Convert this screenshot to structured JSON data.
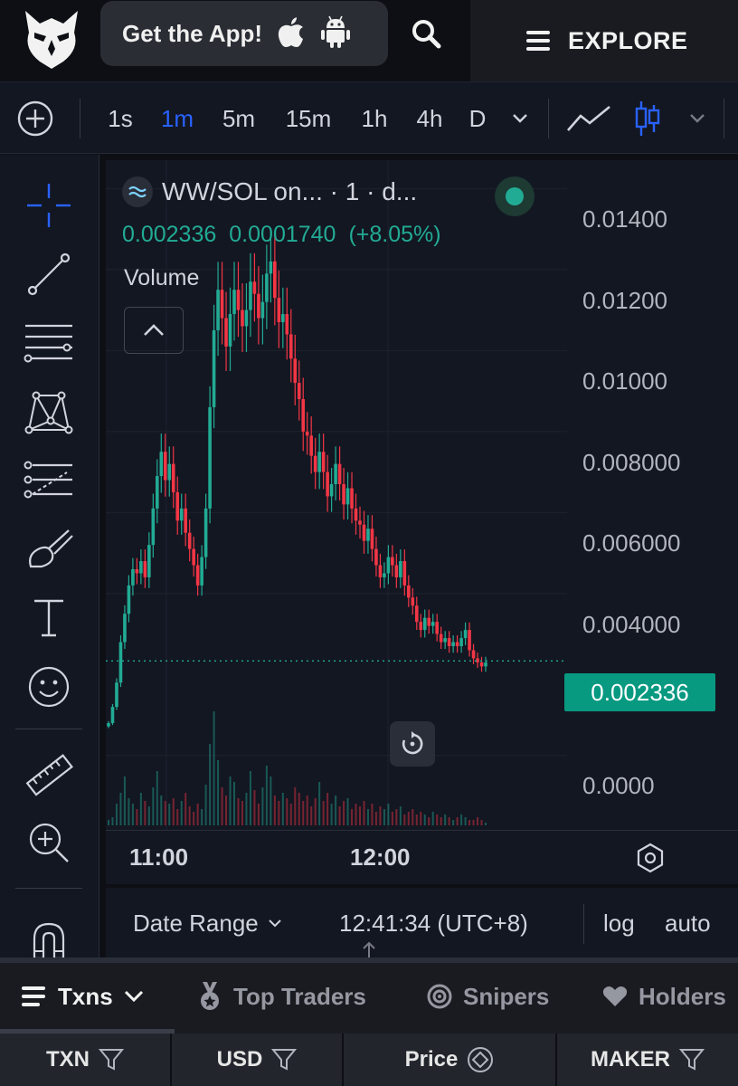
{
  "header": {
    "get_app_label": "Get the App!",
    "explore_label": "EXPLORE"
  },
  "toolbar": {
    "intervals": [
      "1s",
      "1m",
      "5m",
      "15m",
      "1h",
      "4h",
      "D"
    ],
    "active_interval": "1m"
  },
  "chart": {
    "legend_title": "WW/SOL on... · 1 · d...",
    "ohlc_last": "0.002336",
    "ohlc_change": "0.0001740",
    "ohlc_change_pct": "(+8.05%)",
    "volume_label": "Volume",
    "price_ticks": [
      "0.01400",
      "0.01200",
      "0.01000",
      "0.008000",
      "0.006000",
      "0.004000",
      "0.0000"
    ],
    "last_price_label": "0.002336",
    "time_ticks": [
      "11:00",
      "12:00"
    ],
    "colors": {
      "up": "#22ab94",
      "down": "#f23645",
      "accent": "#2962ff"
    }
  },
  "bottombar": {
    "date_range": "Date Range",
    "clock": "12:41:34 (UTC+8)",
    "log": "log",
    "auto": "auto"
  },
  "tabs": [
    {
      "label": "Txns"
    },
    {
      "label": "Top Traders"
    },
    {
      "label": "Snipers"
    },
    {
      "label": "Holders"
    }
  ],
  "table_header": [
    "TXN",
    "USD",
    "Price",
    "MAKER"
  ],
  "chart_data": {
    "type": "candlestick",
    "symbol": "WW/SOL",
    "interval": "1m",
    "x_ticks": [
      "11:00",
      "12:00"
    ],
    "y_ticks": [
      0.0,
      0.004,
      0.006,
      0.008,
      0.01,
      0.012,
      0.014
    ],
    "ylim": [
      0.0,
      0.0147
    ],
    "last_price": 0.002336,
    "grid": true,
    "close_path": [
      0.0008,
      0.0012,
      0.0018,
      0.0028,
      0.0035,
      0.0042,
      0.0046,
      0.0045,
      0.0048,
      0.0044,
      0.0052,
      0.0061,
      0.0069,
      0.0075,
      0.0068,
      0.0072,
      0.0065,
      0.0058,
      0.0061,
      0.0055,
      0.0051,
      0.0047,
      0.0042,
      0.0049,
      0.0061,
      0.0086,
      0.0105,
      0.0115,
      0.0108,
      0.0101,
      0.0109,
      0.0115,
      0.011,
      0.0106,
      0.011,
      0.0117,
      0.0114,
      0.0108,
      0.0112,
      0.0119,
      0.0122,
      0.0113,
      0.0107,
      0.0109,
      0.0104,
      0.0098,
      0.0092,
      0.0088,
      0.008,
      0.0079,
      0.0074,
      0.007,
      0.0075,
      0.007,
      0.0064,
      0.0067,
      0.0072,
      0.0067,
      0.0062,
      0.0066,
      0.0061,
      0.0058,
      0.0057,
      0.0053,
      0.0056,
      0.0051,
      0.0047,
      0.0044,
      0.0045,
      0.0049,
      0.0047,
      0.0044,
      0.0048,
      0.0042,
      0.0039,
      0.0037,
      0.0033,
      0.0031,
      0.0034,
      0.0032,
      0.0033,
      0.003,
      0.0028,
      0.0029,
      0.0027,
      0.0028,
      0.0027,
      0.0029,
      0.0031,
      0.0026,
      0.0024,
      0.0023,
      0.0022,
      0.0023
    ],
    "volume_path": [
      2,
      3,
      8,
      12,
      18,
      10,
      8,
      6,
      12,
      9,
      7,
      14,
      20,
      11,
      9,
      8,
      10,
      6,
      9,
      12,
      7,
      5,
      8,
      6,
      15,
      30,
      42,
      24,
      14,
      11,
      18,
      16,
      10,
      9,
      12,
      20,
      13,
      8,
      14,
      22,
      18,
      11,
      9,
      12,
      10,
      8,
      14,
      12,
      9,
      11,
      7,
      10,
      16,
      9,
      12,
      8,
      11,
      7,
      9,
      10,
      6,
      8,
      7,
      9,
      6,
      8,
      5,
      7,
      6,
      8,
      5,
      6,
      7,
      4,
      5,
      6,
      4,
      5,
      4,
      3,
      5,
      4,
      3,
      4,
      3,
      2,
      3,
      4,
      3,
      2,
      2,
      3,
      2,
      1
    ]
  }
}
